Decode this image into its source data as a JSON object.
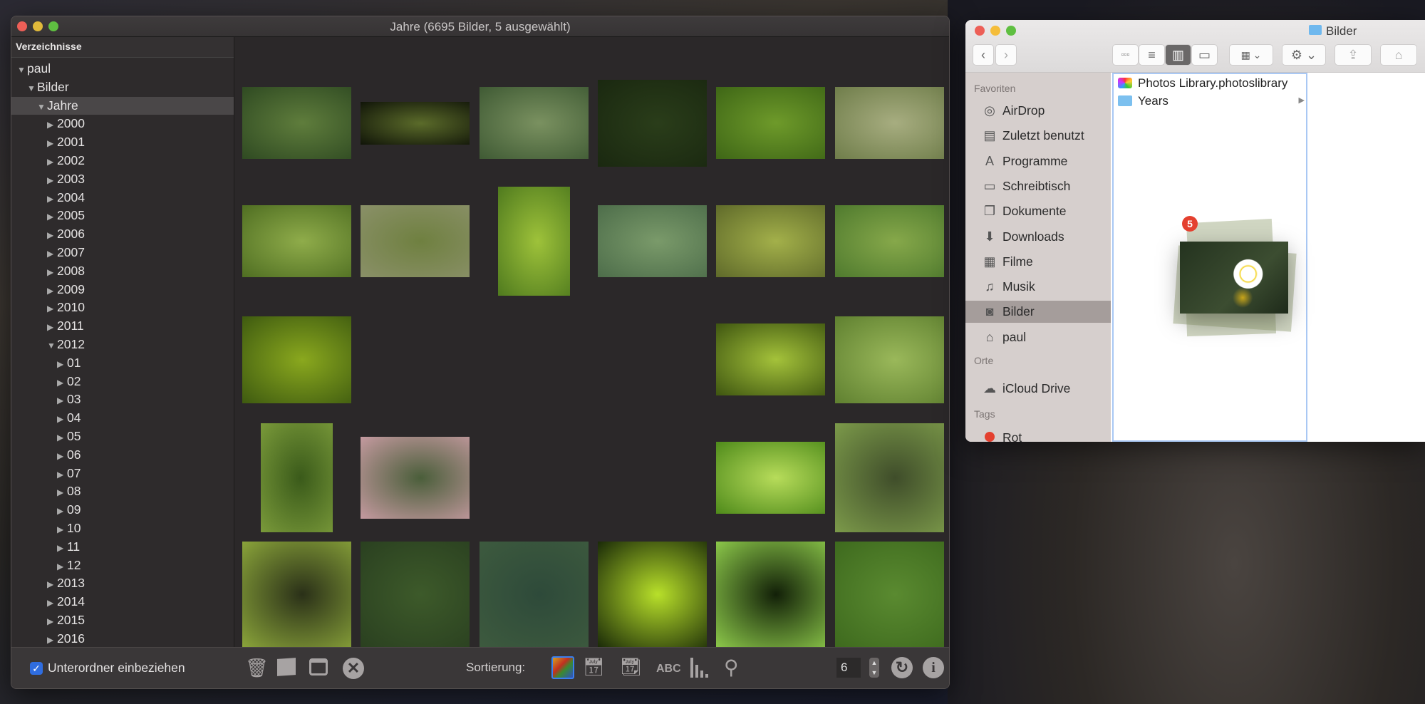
{
  "window": {
    "title": "Jahre (6695 Bilder, 5 ausgewählt)"
  },
  "sidebar": {
    "header": "Verzeichnisse",
    "tree": [
      {
        "label": "paul",
        "level": 0,
        "expanded": true
      },
      {
        "label": "Bilder",
        "level": 1,
        "expanded": true
      },
      {
        "label": "Jahre",
        "level": 2,
        "expanded": true,
        "selected": true
      },
      {
        "label": "2000",
        "level": 3
      },
      {
        "label": "2001",
        "level": 3
      },
      {
        "label": "2002",
        "level": 3
      },
      {
        "label": "2003",
        "level": 3
      },
      {
        "label": "2004",
        "level": 3
      },
      {
        "label": "2005",
        "level": 3
      },
      {
        "label": "2006",
        "level": 3
      },
      {
        "label": "2007",
        "level": 3
      },
      {
        "label": "2008",
        "level": 3
      },
      {
        "label": "2009",
        "level": 3
      },
      {
        "label": "2010",
        "level": 3
      },
      {
        "label": "2011",
        "level": 3
      },
      {
        "label": "2012",
        "level": 3,
        "expanded": true
      },
      {
        "label": "01",
        "level": 4
      },
      {
        "label": "02",
        "level": 4
      },
      {
        "label": "03",
        "level": 4
      },
      {
        "label": "04",
        "level": 4
      },
      {
        "label": "05",
        "level": 4
      },
      {
        "label": "06",
        "level": 4
      },
      {
        "label": "07",
        "level": 4
      },
      {
        "label": "08",
        "level": 4
      },
      {
        "label": "09",
        "level": 4
      },
      {
        "label": "10",
        "level": 4
      },
      {
        "label": "11",
        "level": 4
      },
      {
        "label": "12",
        "level": 4
      },
      {
        "label": "2013",
        "level": 3
      },
      {
        "label": "2014",
        "level": 3
      },
      {
        "label": "2015",
        "level": 3
      },
      {
        "label": "2016",
        "level": 3
      }
    ],
    "include_subfolders": {
      "label": "Unterordner einbeziehen",
      "checked": true
    }
  },
  "thumbnails": [
    {
      "row": 0,
      "col": 0,
      "shape": "land",
      "colors": [
        "#5f7d3c",
        "#2f4a22"
      ]
    },
    {
      "row": 0,
      "col": 1,
      "shape": "wide",
      "colors": [
        "#5b6b2a",
        "#101408"
      ]
    },
    {
      "row": 0,
      "col": 2,
      "shape": "land",
      "colors": [
        "#7a9160",
        "#3f5a34"
      ]
    },
    {
      "row": 0,
      "col": 3,
      "shape": "tall",
      "colors": [
        "#2a3d1a",
        "#1a2810"
      ]
    },
    {
      "row": 0,
      "col": 4,
      "shape": "land",
      "colors": [
        "#6e9a2a",
        "#3e6616"
      ]
    },
    {
      "row": 0,
      "col": 5,
      "shape": "land",
      "colors": [
        "#a7ad80",
        "#6f7d4a"
      ]
    },
    {
      "row": 1,
      "col": 0,
      "shape": "land",
      "colors": [
        "#8fac4a",
        "#4f6e22"
      ]
    },
    {
      "row": 1,
      "col": 1,
      "shape": "land",
      "colors": [
        "#6f8040",
        "#8a9068"
      ]
    },
    {
      "row": 1,
      "col": 2,
      "shape": "portrait",
      "colors": [
        "#9ec23a",
        "#4f7a1e"
      ]
    },
    {
      "row": 1,
      "col": 3,
      "shape": "land",
      "colors": [
        "#7a9a6a",
        "#4d6d4a"
      ]
    },
    {
      "row": 1,
      "col": 4,
      "shape": "land",
      "colors": [
        "#a3b04a",
        "#5f6a2a"
      ]
    },
    {
      "row": 1,
      "col": 5,
      "shape": "land",
      "colors": [
        "#86a84a",
        "#4f7a2e"
      ]
    },
    {
      "row": 2,
      "col": 0,
      "shape": "tall",
      "colors": [
        "#8aa81e",
        "#3e5a10"
      ]
    },
    {
      "row": 2,
      "col": 4,
      "shape": "land",
      "colors": [
        "#a4c23a",
        "#3e5510"
      ]
    },
    {
      "row": 2,
      "col": 5,
      "shape": "tall",
      "colors": [
        "#9ab85a",
        "#5f8030"
      ]
    },
    {
      "row": 3,
      "col": 0,
      "shape": "portrait",
      "colors": [
        "#3a5a1a",
        "#7a9a3a"
      ]
    },
    {
      "row": 3,
      "col": 1,
      "shape": "43",
      "colors": [
        "#4a5e3a",
        "#c59aa0"
      ]
    },
    {
      "row": 3,
      "col": 4,
      "shape": "land",
      "colors": [
        "#b7dc5a",
        "#4e8a1a"
      ]
    },
    {
      "row": 3,
      "col": 5,
      "shape": "square",
      "colors": [
        "#3f4d2a",
        "#7c9a4a"
      ]
    },
    {
      "row": 4,
      "col": 0,
      "shape": "land",
      "colors": [
        "#2a3018",
        "#8aa43a"
      ]
    },
    {
      "row": 4,
      "col": 1,
      "shape": "land",
      "colors": [
        "#3d5a2a",
        "#2a4020"
      ]
    },
    {
      "row": 4,
      "col": 2,
      "shape": "land",
      "colors": [
        "#2e4a3a",
        "#3d5a3e"
      ]
    },
    {
      "row": 4,
      "col": 3,
      "shape": "wide2",
      "colors": [
        "#b8e02a",
        "#1a2a08"
      ]
    },
    {
      "row": 4,
      "col": 4,
      "shape": "43",
      "colors": [
        "#122008",
        "#8cc84a"
      ]
    },
    {
      "row": 4,
      "col": 5,
      "shape": "land",
      "colors": [
        "#5a8a30",
        "#3e6a1e"
      ]
    },
    {
      "row": 5,
      "col": 4,
      "shape": "portrait",
      "colors": [
        "#7faa3a",
        "#4e7a22"
      ]
    }
  ],
  "toolbar": {
    "icons": [
      "trash-icon",
      "stack-icon",
      "window-icon",
      "close-circle-icon"
    ],
    "sort_label": "Sortierung:",
    "sort_options": [
      "color-grid-icon",
      "calendar-camera-icon",
      "calendar-edit-icon",
      "abc-icon",
      "histogram-icon",
      "search-icon"
    ],
    "sort_abc": "ABC",
    "selected_sort": "color-grid-icon",
    "thumb_count": "6",
    "refresh": "refresh-icon",
    "info": "info-icon"
  },
  "finder": {
    "title": "Bilder",
    "sections": {
      "favorites": "Favoriten",
      "places": "Orte",
      "tags": "Tags"
    },
    "favorites": [
      {
        "label": "AirDrop",
        "icon": "airdrop-icon"
      },
      {
        "label": "Zuletzt benutzt",
        "icon": "recents-icon"
      },
      {
        "label": "Programme",
        "icon": "applications-icon"
      },
      {
        "label": "Schreibtisch",
        "icon": "desktop-icon"
      },
      {
        "label": "Dokumente",
        "icon": "documents-icon"
      },
      {
        "label": "Downloads",
        "icon": "downloads-icon"
      },
      {
        "label": "Filme",
        "icon": "movies-icon"
      },
      {
        "label": "Musik",
        "icon": "music-icon"
      },
      {
        "label": "Bilder",
        "icon": "camera-icon",
        "selected": true
      },
      {
        "label": "paul",
        "icon": "home-icon"
      }
    ],
    "places": [
      {
        "label": "iCloud Drive",
        "icon": "cloud-icon"
      }
    ],
    "tags": [
      {
        "label": "Rot",
        "color": "#e4402f"
      }
    ],
    "files": [
      {
        "name": "Photos Library.photoslibrary",
        "icon": "photos-library-icon"
      },
      {
        "name": "Years",
        "icon": "folder-icon",
        "has_children": true
      }
    ],
    "view_mode": "columns",
    "drag_count": "5"
  },
  "colors": {
    "accent": "#2f6de0",
    "badge": "#e4402f",
    "selection": "#4a4748"
  }
}
